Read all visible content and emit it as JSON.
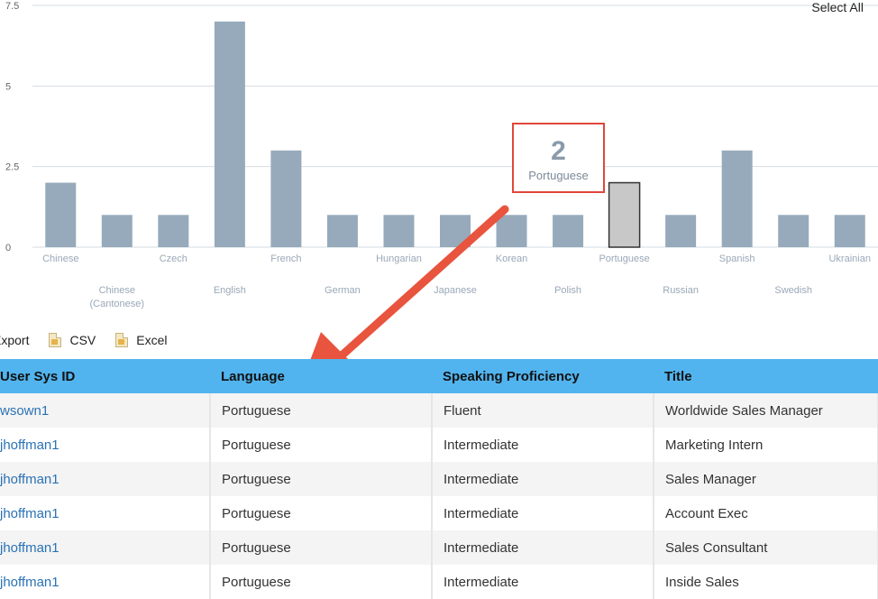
{
  "chart": {
    "select_all_label": "Select All",
    "bar_color": "#97aabb",
    "selected_bar_color": "#c8c8c8",
    "tooltip": {
      "value": "2",
      "label": "Portuguese"
    },
    "tooltip_border_color": "#e0473a",
    "arrow_color": "#e8543e"
  },
  "chart_data": {
    "type": "bar",
    "categories": [
      "Chinese",
      "Chinese (Cantonese)",
      "Czech",
      "English",
      "French",
      "German",
      "Hungarian",
      "Japanese",
      "Korean",
      "Polish",
      "Portuguese",
      "Russian",
      "Spanish",
      "Swedish",
      "Ukrainian"
    ],
    "values": [
      2,
      1,
      1,
      7,
      3,
      1,
      1,
      1,
      1,
      1,
      2,
      1,
      3,
      1,
      1
    ],
    "highlighted": "Portuguese",
    "yticks": [
      "0",
      "2.5",
      "5",
      "7.5"
    ],
    "ylim": [
      0,
      7.5
    ],
    "grid": true
  },
  "export": {
    "label": "Export",
    "csv_label": "CSV",
    "excel_label": "Excel",
    "icon": "file-icon"
  },
  "table": {
    "header_color": "#52b4ee",
    "columns": [
      "User Sys ID",
      "Language",
      "Speaking Proficiency",
      "Title"
    ],
    "rows": [
      {
        "user": "wsown1",
        "language": "Portuguese",
        "proficiency": "Fluent",
        "title": "Worldwide Sales Manager"
      },
      {
        "user": "jhoffman1",
        "language": "Portuguese",
        "proficiency": "Intermediate",
        "title": "Marketing Intern"
      },
      {
        "user": "jhoffman1",
        "language": "Portuguese",
        "proficiency": "Intermediate",
        "title": "Sales Manager"
      },
      {
        "user": "jhoffman1",
        "language": "Portuguese",
        "proficiency": "Intermediate",
        "title": "Account Exec"
      },
      {
        "user": "jhoffman1",
        "language": "Portuguese",
        "proficiency": "Intermediate",
        "title": "Sales Consultant"
      },
      {
        "user": "jhoffman1",
        "language": "Portuguese",
        "proficiency": "Intermediate",
        "title": "Inside Sales"
      }
    ]
  }
}
